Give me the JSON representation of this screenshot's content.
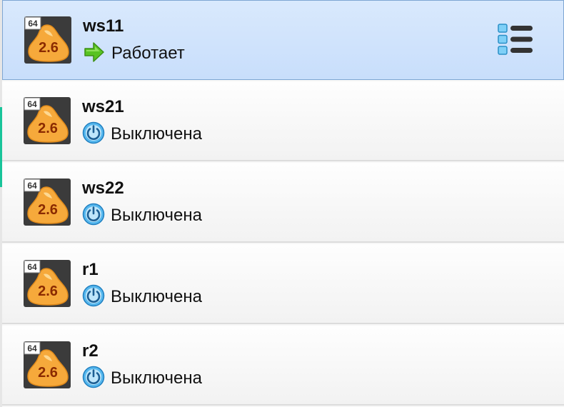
{
  "vm_list": {
    "items": [
      {
        "name": "ws11",
        "state": "Работает",
        "state_icon": "running-arrow-icon",
        "os_arch": "64",
        "os_version": "2.6",
        "selected": true
      },
      {
        "name": "ws21",
        "state": "Выключена",
        "state_icon": "power-off-icon",
        "os_arch": "64",
        "os_version": "2.6",
        "selected": false
      },
      {
        "name": "ws22",
        "state": "Выключена",
        "state_icon": "power-off-icon",
        "os_arch": "64",
        "os_version": "2.6",
        "selected": false
      },
      {
        "name": "r1",
        "state": "Выключена",
        "state_icon": "power-off-icon",
        "os_arch": "64",
        "os_version": "2.6",
        "selected": false
      },
      {
        "name": "r2",
        "state": "Выключена",
        "state_icon": "power-off-icon",
        "os_arch": "64",
        "os_version": "2.6",
        "selected": false
      }
    ],
    "menu_icon": "vm-menu-icon"
  },
  "colors": {
    "selection_bg": "#cfe2fc",
    "selection_border": "#7ea6d3",
    "accent_strip": "#19c49a",
    "os_icon_orange": "#f6a93b",
    "running_green": "#58c322",
    "power_blue": "#2a9fe3"
  }
}
